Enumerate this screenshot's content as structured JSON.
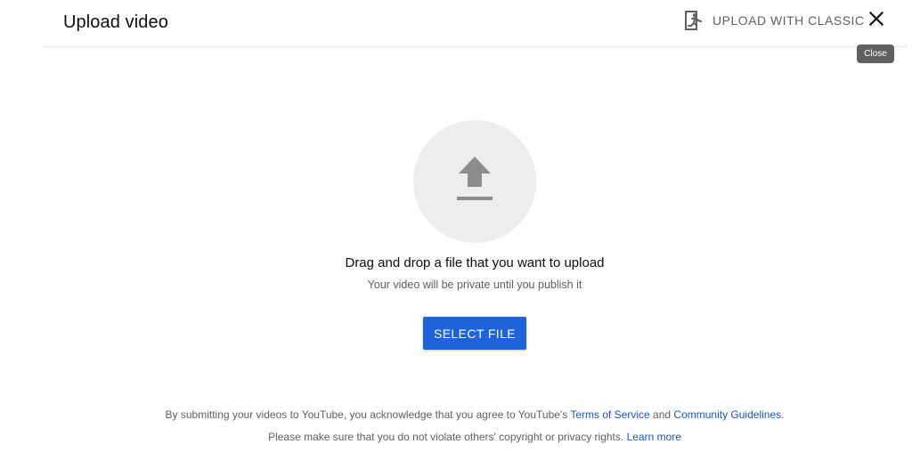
{
  "header": {
    "title": "Upload video",
    "classic_label": "UPLOAD WITH CLASSIC",
    "classic_icon": "exit-run-icon",
    "close_icon": "close-icon",
    "close_tooltip": "Close"
  },
  "main": {
    "upload_icon": "upload-arrow-icon",
    "drag_text": "Drag and drop a file that you want to upload",
    "private_text": "Your video will be private until you publish it",
    "select_button": "SELECT FILE"
  },
  "footer": {
    "line1_prefix": "By submitting your videos to YouTube, you acknowledge that you agree to YouTube's ",
    "terms_link": "Terms of Service",
    "line1_and": " and ",
    "guidelines_link": "Community Guidelines",
    "line1_suffix": ".",
    "line2_prefix": "Please make sure that you do not violate others' copyright or privacy rights. ",
    "learn_more_link": "Learn more"
  },
  "colors": {
    "accent": "#1f63d8",
    "link": "#1a56c4",
    "muted_text": "#606060",
    "circle_bg": "#ededed"
  }
}
